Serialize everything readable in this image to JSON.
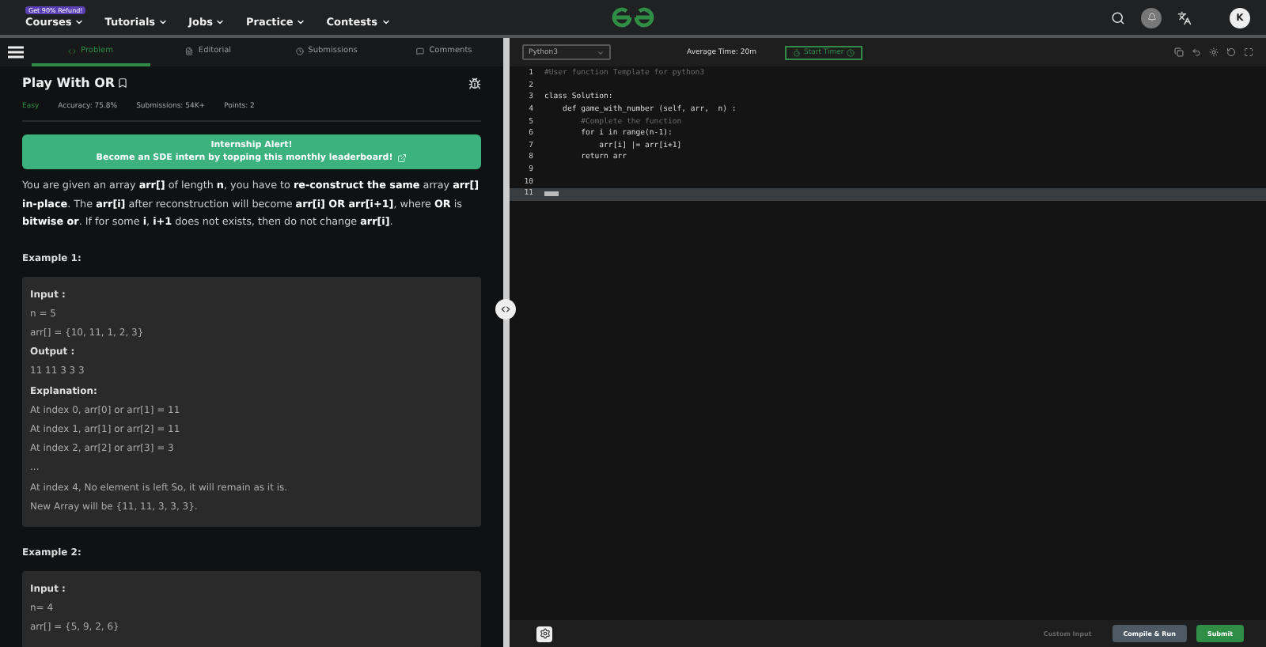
{
  "nav": {
    "badge": "Get 90% Refund!",
    "items": [
      "Courses",
      "Tutorials",
      "Jobs",
      "Practice",
      "Contests"
    ],
    "avatar": "K"
  },
  "tabs": [
    {
      "label": "Problem",
      "selected": true,
      "kind": "code"
    },
    {
      "label": "Editorial",
      "selected": false,
      "kind": "doc"
    },
    {
      "label": "Submissions",
      "selected": false,
      "kind": "clock"
    },
    {
      "label": "Comments",
      "selected": false,
      "kind": "chat"
    }
  ],
  "problem": {
    "title": "Play With OR",
    "difficulty": "Easy",
    "meta": [
      "Accuracy: 75.8%",
      "Submissions: 54K+",
      "Points: 2"
    ],
    "banner": {
      "title": "Internship Alert!",
      "text": "Become an SDE intern by topping this monthly leaderboard!"
    },
    "description": "You are given an array **arr[]** of length **n**, you have to **re-construct the same** array **arr[] in-place**. The **arr[i]** after reconstruction will become **arr[i] OR arr[i+1]**, where **OR** is **bitwise or**. If for some **i**, **i+1** does not exists, then do not change **arr[i]**.",
    "examples": [
      {
        "heading": "Example 1:",
        "lines": [
          {
            "kind": "label",
            "text": "Input :"
          },
          {
            "kind": "text",
            "text": "n = 5"
          },
          {
            "kind": "text",
            "text": "arr[] = {10, 11, 1, 2, 3}"
          },
          {
            "kind": "label",
            "text": "Output :"
          },
          {
            "kind": "text",
            "text": "11 11 3 3 3"
          },
          {
            "kind": "label",
            "text": "Explanation:"
          },
          {
            "kind": "text",
            "text": "At index 0, arr[0] or arr[1] = 11"
          },
          {
            "kind": "text",
            "text": "At index 1, arr[1] or arr[2] = 11"
          },
          {
            "kind": "text",
            "text": "At index 2, arr[2] or arr[3] = 3"
          },
          {
            "kind": "text",
            "text": "..."
          },
          {
            "kind": "text",
            "text": "At index 4, No element is left So, it will remain as it is."
          },
          {
            "kind": "text",
            "text": "New Array will be {11, 11, 3, 3, 3}."
          }
        ]
      },
      {
        "heading": "Example 2:",
        "lines": [
          {
            "kind": "label",
            "text": "Input :"
          },
          {
            "kind": "text",
            "text": "n= 4"
          },
          {
            "kind": "text",
            "text": "arr[] = {5, 9, 2, 6}"
          }
        ]
      }
    ]
  },
  "editor": {
    "language": "Python3",
    "average_time": "Average Time: 20m",
    "timer_button": "Start Timer",
    "lines": [
      {
        "number": "1",
        "kind": "comment",
        "text": "#User function Template for python3"
      },
      {
        "number": "2",
        "kind": "code"
      },
      {
        "number": "3",
        "kind": "code",
        "text": "class Solution:"
      },
      {
        "number": "4",
        "kind": "code",
        "text": "    def game_with_number (self, arr,  n) :"
      },
      {
        "number": "5",
        "kind": "comment",
        "text": "        #Complete the function"
      },
      {
        "number": "6",
        "kind": "code",
        "text": "        for i in range(n-1):"
      },
      {
        "number": "7",
        "kind": "code",
        "text": "            arr[i] |= arr[i+1]"
      },
      {
        "number": "8",
        "kind": "code",
        "text": "        return arr"
      },
      {
        "number": "9",
        "kind": "code"
      },
      {
        "number": "10",
        "kind": "code"
      },
      {
        "number": "11",
        "kind": "current"
      }
    ],
    "buttons": [
      {
        "kind": "plain",
        "label": "Custom Input"
      },
      {
        "kind": "secondary",
        "label": "Compile & Run"
      },
      {
        "kind": "primary",
        "label": "Submit"
      }
    ]
  }
}
